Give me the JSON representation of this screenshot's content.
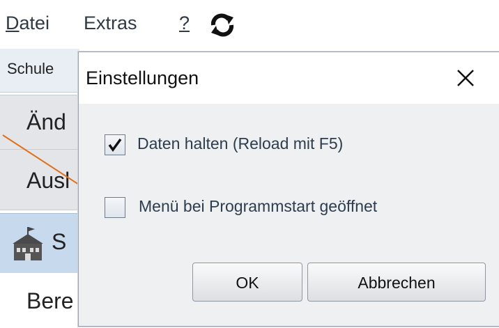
{
  "menubar": {
    "datei_first": "D",
    "datei_rest": "atei",
    "extras": "Extras",
    "help": "?",
    "refresh_icon": "refresh-icon"
  },
  "background": {
    "tab_schule": "Schule",
    "row1": "Änd",
    "row2": "Ausl",
    "row3_icon": "school-icon",
    "row3": "S",
    "row4": "Bere"
  },
  "dialog": {
    "title": "Einstellungen",
    "close_icon": "close-icon",
    "option1": {
      "label": "Daten halten (Reload mit F5)",
      "checked": true
    },
    "option2": {
      "label": "Menü bei Programmstart geöffnet",
      "checked": false
    },
    "ok_label": "OK",
    "cancel_label": "Abbrechen"
  },
  "annotation": {
    "arrow_color": "#e0701a"
  }
}
